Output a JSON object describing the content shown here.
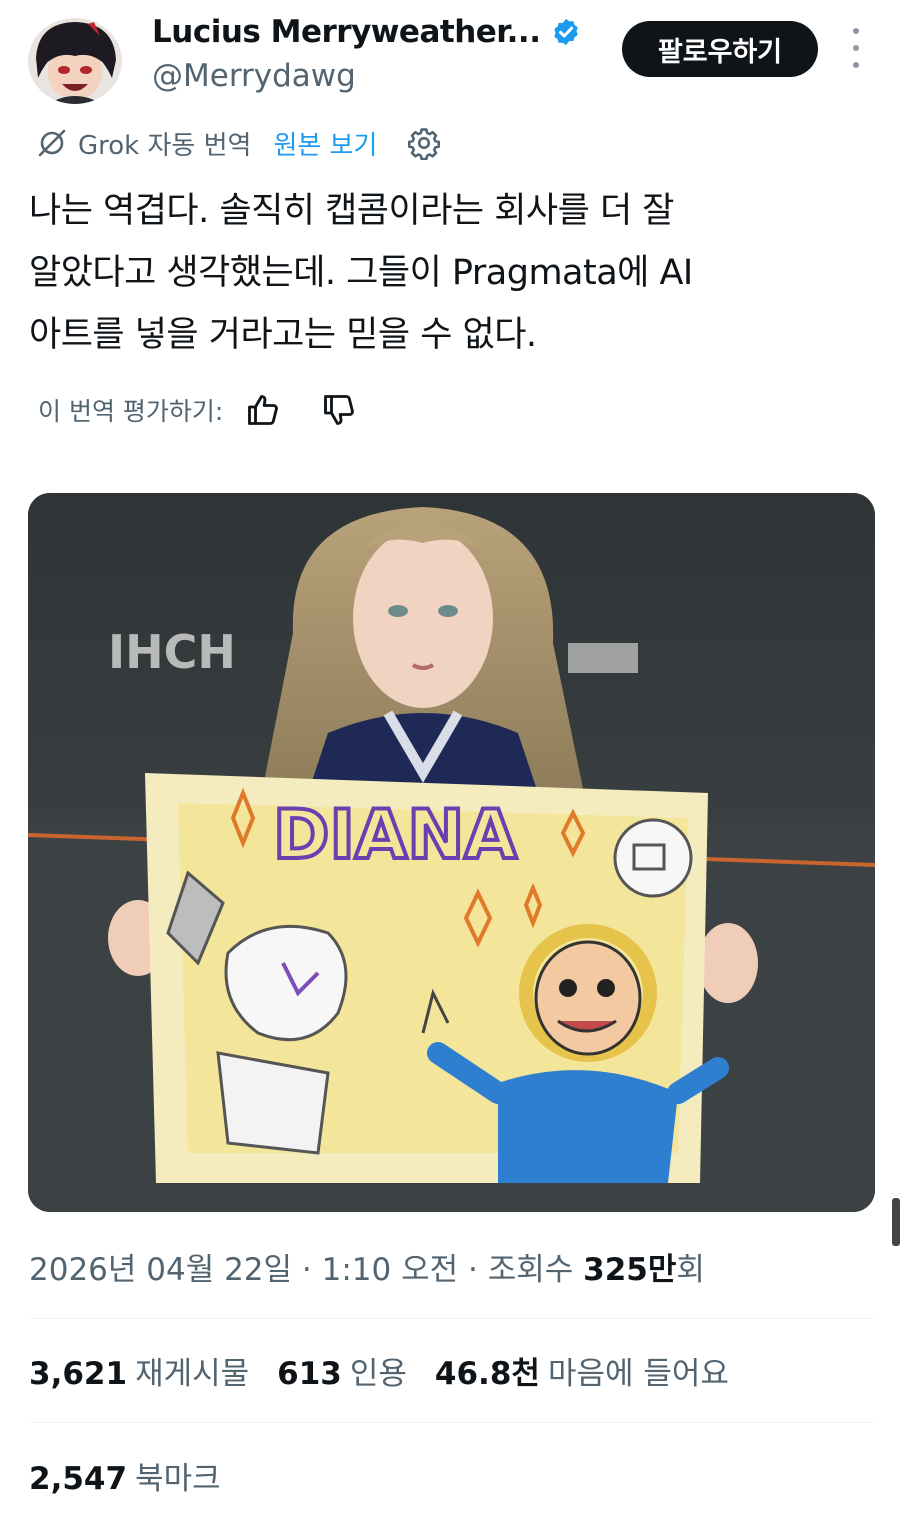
{
  "author": {
    "display_name": "Lucius Merryweather...",
    "handle": "@Merrydawg",
    "verified": true,
    "verified_color": "#1d9bf0"
  },
  "actions": {
    "follow_label": "팔로우하기"
  },
  "translation": {
    "grok_label": "Grok 자동 번역",
    "show_original_label": "원본 보기",
    "rate_label": "이 번역 평가하기:"
  },
  "tweet": {
    "lines": [
      "나는 역겹다. 솔직히 캡콤이라는 회사를 더 잘",
      "알았다고 생각했는데. 그들이 Pragmata에 AI",
      "아트를 넣을 거라고는 믿을 수 없다."
    ]
  },
  "media": {
    "drawing_text": "DIANA",
    "wall_text": "IHCH"
  },
  "meta": {
    "date": "2026년 04월 22일",
    "time": "1:10 오전",
    "views_label": "조회수",
    "views_value": "325만",
    "views_suffix": "회"
  },
  "stats": {
    "reposts_value": "3,621",
    "reposts_label": "재게시물",
    "quotes_value": "613",
    "quotes_label": "인용",
    "likes_value": "46.8천",
    "likes_label": "마음에 들어요",
    "bookmarks_value": "2,547",
    "bookmarks_label": "북마크"
  },
  "colors": {
    "accent": "#1d9bf0",
    "text_primary": "#0f1419",
    "text_secondary": "#536471"
  }
}
